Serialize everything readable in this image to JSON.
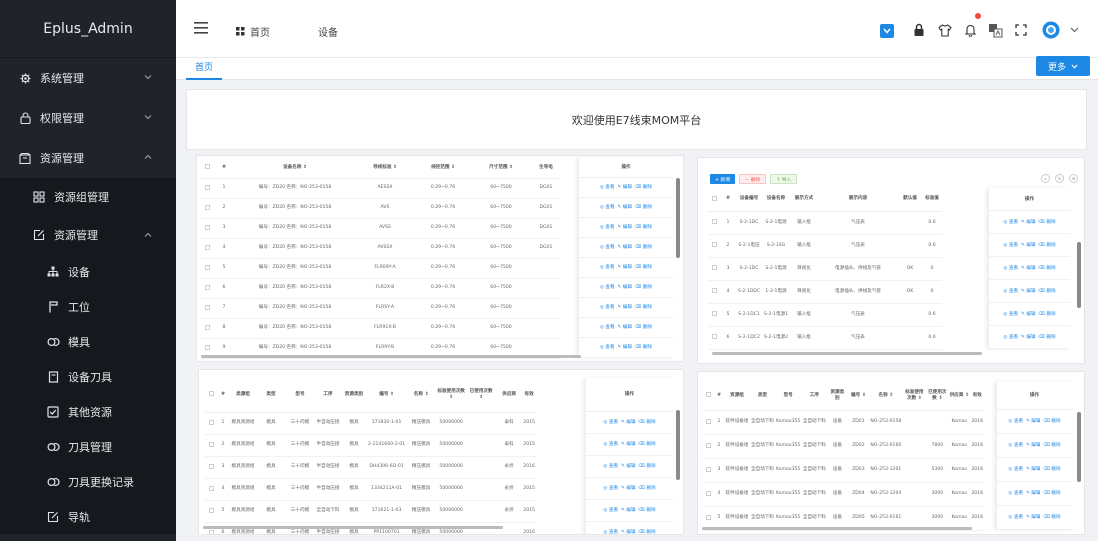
{
  "app": {
    "title": "Eplus_Admin"
  },
  "sidebar": {
    "items": [
      {
        "label": "系统管理",
        "level": 1,
        "icon": "gear-icon",
        "expanded": false
      },
      {
        "label": "权限管理",
        "level": 1,
        "icon": "lock-icon",
        "expanded": false
      },
      {
        "label": "资源管理",
        "level": 1,
        "icon": "box-icon",
        "expanded": true
      },
      {
        "label": "资源组管理",
        "level": 2,
        "icon": "grid-icon"
      },
      {
        "label": "资源管理",
        "level": 2,
        "icon": "edit-icon",
        "expanded": true
      },
      {
        "label": "设备",
        "level": 3,
        "icon": "sitemap-icon"
      },
      {
        "label": "工位",
        "level": 3,
        "icon": "flag-icon"
      },
      {
        "label": "模具",
        "level": 3,
        "icon": "link-icon"
      },
      {
        "label": "设备刀具",
        "level": 3,
        "icon": "book-icon"
      },
      {
        "label": "其他资源",
        "level": 3,
        "icon": "checkbox-icon"
      },
      {
        "label": "刀具管理",
        "level": 3,
        "icon": "link-icon"
      },
      {
        "label": "刀具更换记录",
        "level": 3,
        "icon": "link-icon"
      },
      {
        "label": "导轨",
        "level": 3,
        "icon": "edit-icon"
      }
    ]
  },
  "header": {
    "breadcrumb": [
      "首页",
      "设备"
    ]
  },
  "tabs": {
    "home": "首页",
    "more": "更多"
  },
  "welcome": "欢迎使用E7线束MOM平台",
  "ops": [
    "查看",
    "编辑",
    "删除"
  ],
  "accent": "#1e88e5",
  "panel1": {
    "headers": [
      "#",
      "设备名称 ⇕",
      "导线标准 ⇕",
      "线径范围 ⇕",
      "尺寸范围 ⇕",
      "生导电",
      "操作"
    ],
    "rows": [
      {
        "n": "1",
        "name": "编号：ZD20 名称：NO-253-0158",
        "std": "AESSX",
        "d": "0.29~0.76",
        "s": "60~7500",
        "g": "DG01"
      },
      {
        "n": "2",
        "name": "编号：ZD20 名称：NO-253-0158",
        "std": "AVS",
        "d": "0.29~0.76",
        "s": "60~7500",
        "g": "DG01"
      },
      {
        "n": "3",
        "name": "编号：ZD20 名称：NO-253-0158",
        "std": "AVSS",
        "d": "0.29~0.76",
        "s": "60~7500",
        "g": "DG01"
      },
      {
        "n": "4",
        "name": "编号：ZD20 名称：NO-253-0158",
        "std": "AVSSX",
        "d": "0.29~0.76",
        "s": "60~7500",
        "g": "DG01"
      },
      {
        "n": "5",
        "name": "编号：ZD20 名称：NO-253-0158",
        "std": "FLR09Y-A",
        "d": "0.29~0.76",
        "s": "60~7500",
        "g": ""
      },
      {
        "n": "6",
        "name": "编号：ZD20 名称：NO-253-0158",
        "std": "FLR2X-B",
        "d": "0.29~0.76",
        "s": "60~7500",
        "g": ""
      },
      {
        "n": "7",
        "name": "编号：ZD20 名称：NO-253-0158",
        "std": "FLRSY-A",
        "d": "0.29~0.76",
        "s": "60~7500",
        "g": ""
      },
      {
        "n": "8",
        "name": "编号：ZD20 名称：NO-253-0158",
        "std": "FLR91X-B",
        "d": "0.29~0.76",
        "s": "60~7500",
        "g": ""
      },
      {
        "n": "9",
        "name": "编号：ZD20 名称：NO-253-0158",
        "std": "FLR9Y-B",
        "d": "0.29~0.76",
        "s": "60~7500",
        "g": ""
      }
    ]
  },
  "panel2": {
    "buttons": [
      "+ 新增",
      "− 删除",
      "↑ 导入"
    ],
    "headers": [
      "#",
      "设备编号",
      "设备名称",
      "展示方式",
      "展示内容",
      "默认值",
      "标准值",
      "操作"
    ],
    "rows": [
      {
        "n": "1",
        "code": "S-2-1DC",
        "name": "S-2-1电源",
        "mode": "输入框",
        "content": "气压表",
        "def": "",
        "std": "0.6"
      },
      {
        "n": "2",
        "code": "S-2-1电压",
        "name": "S-2-1SG",
        "mode": "输入框",
        "content": "气压表",
        "def": "",
        "std": "0.6"
      },
      {
        "n": "3",
        "code": "S-2-1DC",
        "name": "S-2-1电源",
        "mode": "目视化",
        "content": "电源插头、供线及气管",
        "def": "OK",
        "std": "0"
      },
      {
        "n": "4",
        "code": "S-2-1DDC",
        "name": "1-2-1电源",
        "mode": "目视化",
        "content": "电源插头、供线及气管",
        "def": "OK",
        "std": "0"
      },
      {
        "n": "5",
        "code": "S-2-1DC1",
        "name": "S-2-1电源1",
        "mode": "输入框",
        "content": "气压表",
        "def": "",
        "std": "0.6"
      },
      {
        "n": "6",
        "code": "S-2-1DC2",
        "name": "S-2-1电源2",
        "mode": "输入框",
        "content": "气压表",
        "def": "",
        "std": "0.6"
      }
    ]
  },
  "panel3": {
    "headers": [
      "#",
      "类源组",
      "类型",
      "型号",
      "工序",
      "资源类别",
      "编号 ⇕",
      "名称 ⇕",
      "标准使用次数 ⇕",
      "已使用次数 ⇕",
      "供应商",
      "有效",
      "操作"
    ],
    "rows": [
      {
        "n": "1",
        "g": "模具资源组",
        "t": "模具",
        "m": "三十问模",
        "p": "半自动压接",
        "c": "模具",
        "no": "171830-1-01",
        "name": "精压模具",
        "std": "50000000",
        "used": "",
        "sup": "泰科",
        "y": "2015"
      },
      {
        "n": "2",
        "g": "模具资源组",
        "t": "模具",
        "m": "三十问模",
        "p": "半自动压接",
        "c": "模具",
        "no": "2-2141660-2-01",
        "name": "精压模具",
        "std": "50000000",
        "used": "",
        "sup": "泰科",
        "y": "2015"
      },
      {
        "n": "3",
        "g": "模具资源组",
        "t": "模具",
        "m": "三十问模",
        "p": "半自动压接",
        "c": "模具",
        "no": "DH4306-6D-01",
        "name": "精压模具",
        "std": "50000000",
        "used": "",
        "sup": "永侨",
        "y": "2016"
      },
      {
        "n": "4",
        "g": "模具资源组",
        "t": "模具",
        "m": "三十问模",
        "p": "半自动压接",
        "c": "模具",
        "no": "1334211A-01",
        "name": "精压模具",
        "std": "50000000",
        "used": "",
        "sup": "永侨",
        "y": "2015"
      },
      {
        "n": "5",
        "g": "模具资源组",
        "t": "模具",
        "m": "三十问模",
        "p": "全自动下料",
        "c": "模具",
        "no": "171621-1-03",
        "name": "精压模具",
        "std": "50000000",
        "used": "",
        "sup": "永侨",
        "y": "2015"
      },
      {
        "n": "6",
        "g": "模具资源组",
        "t": "模具",
        "m": "三十问模",
        "p": "半自动压接",
        "c": "模具",
        "no": "PP1100701",
        "name": "精压模具",
        "std": "50000000",
        "used": "",
        "sup": "",
        "y": "2016"
      }
    ]
  },
  "panel4": {
    "headers": [
      "#",
      "资源组",
      "类型",
      "型号",
      "工序",
      "资源类别",
      "编号 ⇕",
      "名称 ⇕",
      "标准使用次数 ⇕",
      "已使用次数 ⇕",
      "供应商 ⇕",
      "有效",
      "操作"
    ],
    "rows": [
      {
        "n": "1",
        "g": "软件设备组",
        "t": "全自动下料",
        "m": "Komax355",
        "p": "全自动下料",
        "c": "设备",
        "no": "ZD01",
        "name": "NO-253-0158",
        "std": "",
        "used": "",
        "sup": "Komax",
        "y": "2016"
      },
      {
        "n": "2",
        "g": "软件设备组",
        "t": "全自动下料",
        "m": "Komax355",
        "p": "全自动下料",
        "c": "设备",
        "no": "ZD02",
        "name": "NO-253-0160",
        "std": "",
        "used": "7800",
        "sup": "Komax",
        "y": "2016"
      },
      {
        "n": "3",
        "g": "软件设备组",
        "t": "全自动下料",
        "m": "Komax355",
        "p": "全自动下料",
        "c": "设备",
        "no": "ZD03",
        "name": "NO-253-1201",
        "std": "",
        "used": "5300",
        "sup": "Komax",
        "y": "2016"
      },
      {
        "n": "4",
        "g": "软件设备组",
        "t": "全自动下料",
        "m": "Komax355",
        "p": "全自动下料",
        "c": "设备",
        "no": "ZD04",
        "name": "NO-253-1204",
        "std": "",
        "used": "3000",
        "sup": "Komax",
        "y": "2016"
      },
      {
        "n": "5",
        "g": "软件设备组",
        "t": "全自动下料",
        "m": "Komax355",
        "p": "全自动下料",
        "c": "设备",
        "no": "ZD05",
        "name": "NO-253-0161",
        "std": "",
        "used": "3000",
        "sup": "Komax",
        "y": "2016"
      }
    ]
  }
}
